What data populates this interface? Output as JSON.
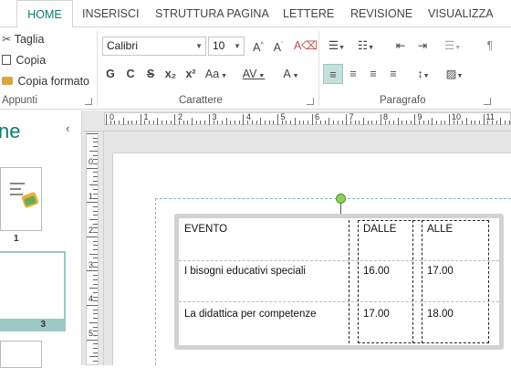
{
  "tabs": [
    {
      "label": "HOME",
      "active": true
    },
    {
      "label": "INSERISCI"
    },
    {
      "label": "STRUTTURA PAGINA"
    },
    {
      "label": "LETTERE"
    },
    {
      "label": "REVISIONE"
    },
    {
      "label": "VISUALIZZA"
    }
  ],
  "clipboard": {
    "cut": "Taglia",
    "copy": "Copia",
    "format_painter": "Copia formato",
    "group_label": "Appunti"
  },
  "font": {
    "name": "Calibri",
    "size": "10",
    "group_label": "Carattere",
    "buttons": {
      "bold": "G",
      "italic": "C",
      "strike": "S",
      "sub": "x₂",
      "sup": "x²",
      "case": "Aa",
      "spacing": "AV",
      "color": "A"
    }
  },
  "paragraph": {
    "group_label": "Paragrafo"
  },
  "pane": {
    "title": "ne",
    "pages": [
      {
        "number": "1"
      },
      {
        "number": "3"
      }
    ]
  },
  "ruler": {
    "h": [
      "0",
      "1",
      "2",
      "3",
      "4",
      "5",
      "6",
      "7",
      "8",
      "9",
      "10",
      "11"
    ],
    "v": [
      "0",
      "1",
      "2",
      "3",
      "4",
      "5"
    ]
  },
  "table": {
    "header": [
      "EVENTO",
      "DALLE",
      "ALLE"
    ],
    "rows": [
      [
        "I bisogni educativi speciali",
        "16.00",
        "17.00"
      ],
      [
        "La didattica per competenze",
        "17.00",
        "18.00"
      ]
    ]
  },
  "colors": {
    "accent": "#0e7c71",
    "selection": "#c4e0dc"
  }
}
